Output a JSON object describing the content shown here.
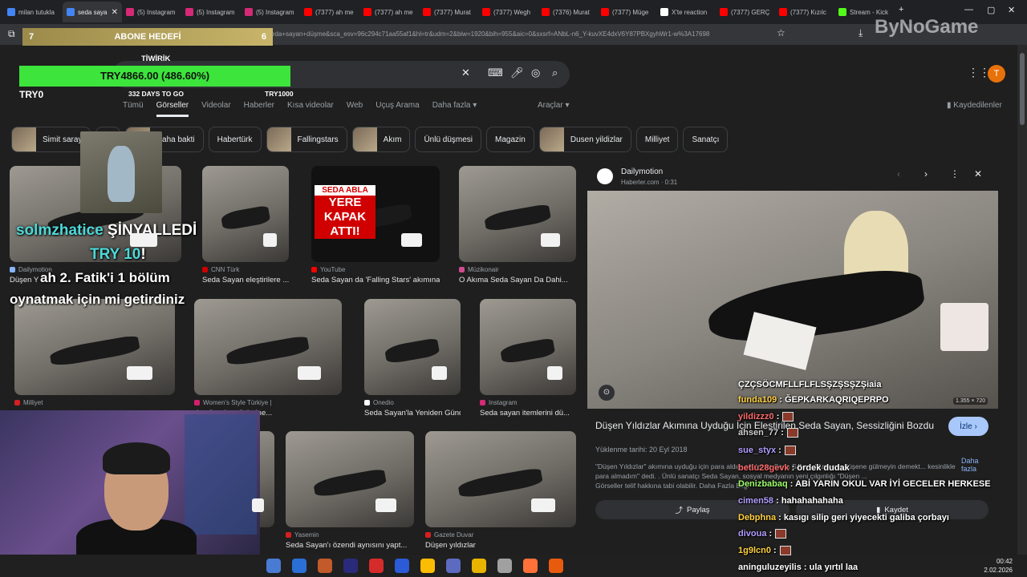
{
  "browser": {
    "tabs": [
      {
        "label": "milan tutukla",
        "color": "#4285f4",
        "active": false
      },
      {
        "label": "seda saya",
        "color": "#4285f4",
        "active": true
      },
      {
        "label": "(5) Instagram",
        "color": "#d62976",
        "active": false
      },
      {
        "label": "(5) Instagram",
        "color": "#d62976",
        "active": false
      },
      {
        "label": "(5) Instagram",
        "color": "#d62976",
        "active": false
      },
      {
        "label": "(7377) ah me",
        "color": "#ff0000",
        "active": false
      },
      {
        "label": "(7377) ah me",
        "color": "#ff0000",
        "active": false
      },
      {
        "label": "(7377) Murat",
        "color": "#ff0000",
        "active": false
      },
      {
        "label": "(7377) Wegh",
        "color": "#ff0000",
        "active": false
      },
      {
        "label": "(7376) Murat",
        "color": "#ff0000",
        "active": false
      },
      {
        "label": "(7377) Müge",
        "color": "#ff0000",
        "active": false
      },
      {
        "label": "X'te reaction",
        "color": "#ffffff",
        "active": false
      },
      {
        "label": "(7377) GERÇ",
        "color": "#ff0000",
        "active": false
      },
      {
        "label": "(7377) Kızılc",
        "color": "#ff0000",
        "active": false
      },
      {
        "label": "Stream - Kick",
        "color": "#53fc18",
        "active": false
      }
    ],
    "url": "eda+sayan+düşme&sca_esv=96c294c71aa55af1&hl=tr&udm=2&biw=1920&bih=955&aic=0&sxsrf=ANbL-n6_Y-kuvXE4dxV6Y87PBXgyhWr1-w%3A17698"
  },
  "google": {
    "nav": [
      "Tümü",
      "Görseller",
      "Videolar",
      "Haberler",
      "Kısa videolar",
      "Web",
      "Uçuş Arama",
      "Daha fazla ▾"
    ],
    "nav_active": "Görseller",
    "tools": "Araçlar ▾",
    "saved": "Kaydedilenler",
    "avatar": "T",
    "chips": [
      {
        "label": "Simit saray",
        "thumb": true
      },
      {
        "label": "rs",
        "thumb": false
      },
      {
        "label": "Daha bakti",
        "thumb": true
      },
      {
        "label": "Habertürk",
        "thumb": false
      },
      {
        "label": "Fallingstars",
        "thumb": true
      },
      {
        "label": "Akım",
        "thumb": true
      },
      {
        "label": "Ünlü düşmesi",
        "thumb": false
      },
      {
        "label": "Magazin",
        "thumb": false
      },
      {
        "label": "Dusen yildizlar",
        "thumb": true
      },
      {
        "label": "Milliyet",
        "thumb": false
      },
      {
        "label": "Sanatçı",
        "thumb": false
      }
    ],
    "results": [
      {
        "source": "Dailymotion",
        "caption": "Düşen Y"
      },
      {
        "source": "CNN Türk",
        "caption": "Seda Sayan eleştirilere ..."
      },
      {
        "source": "YouTube",
        "caption": "Seda Sayan da 'Falling Stars' akımına ..."
      },
      {
        "source": "Müzikonair",
        "caption": "O Akıma Seda Sayan Da Dahi..."
      },
      {
        "source": "Milliyet",
        "caption": ""
      },
      {
        "source": "Women's Style Türkiye |",
        "caption": "de görenler gözlerine..."
      },
      {
        "source": "Onedio",
        "caption": "Seda Sayan'la Yeniden Günd..."
      },
      {
        "source": "Instagram",
        "caption": "Seda sayan itemlerini dü..."
      },
      {
        "source": "Yasemin",
        "caption": "Seda Sayan'ı özendi aynısını yapt..."
      },
      {
        "source": "Gazete Duvar",
        "caption": "Düşen yıldızlar"
      },
      {
        "source": "",
        "caption": "a"
      }
    ],
    "thumb_text": [
      "SEDA ABLA",
      "YERE",
      "KAPAK",
      "ATTI!"
    ]
  },
  "panel": {
    "site": "Dailymotion",
    "subsite": "Haberler.com · 0:31",
    "size": "1.355 × 720",
    "title": "Düşen Yıldızlar Akımına Uyduğu İçin Eleştirilen Seda Sayan, Sessizliğini Bozdu",
    "visit": "İzle ›",
    "date": "Yüklenme tarihi: 20 Eyl 2018",
    "desc": "\"Düşen Yıldızlar\" akımına uyduğu için para aldığı söylenen Seda Sayan, \"Amacım düşene gülmeyin demekt... kesinlikle para almadım\" dedi. . Ünlü sanatçı Seda Sayan, sosyal medyanın yeni çılgınlığı \"Düşen ...",
    "more": "Daha fazla",
    "rights": "Görseller telif hakkına tabi olabilir. Daha Fazla Bilgi",
    "share": "Paylaş",
    "save": "Kaydet"
  },
  "overlay": {
    "abone_left": "7",
    "abone_label": "ABONE HEDEFİ",
    "abone_right": "6",
    "tiwirik": "TİWİRİK",
    "goal_text": "TRY4866.00 (486.60%)",
    "goal_fraction": 1,
    "goal_min": "TRY0",
    "goal_days": "332 DAYS TO GO",
    "goal_max": "TRY1000",
    "alert_user": "solmzhatice",
    "alert_action": "ŞİNYALLEDİ",
    "alert_amount": "TRY 10",
    "alert_bang": "!",
    "alert_msg1": "ah 2. Fatik'i 1 bölüm",
    "alert_msg2": "oynatmak için mi getirdiniz",
    "watermark": "ByNoGame"
  },
  "chat": [
    {
      "user": "",
      "msg": "ÇZÇSÖCMFLLFLFLSŞZŞSŞZŞiaia",
      "color": "#ffffff",
      "badge": false
    },
    {
      "user": "funda109",
      "msg": ": ĞEPKARKAQRIQEPRPO",
      "color": "#ffd23f",
      "badge": false
    },
    {
      "user": "yildizzz0",
      "msg": ":",
      "color": "#ff6b6b",
      "badge": true
    },
    {
      "user": "ahsen_77",
      "msg": ":",
      "color": "#cfcfcf",
      "badge": true
    },
    {
      "user": "sue_styx",
      "msg": ":",
      "color": "#b19dff",
      "badge": true
    },
    {
      "user": "betlu28gevk",
      "msg": ": ördek dudak",
      "color": "#ff6b6b",
      "badge": false
    },
    {
      "user": "Denizbabaq",
      "msg": ": ABİ YARIN OKUL VAR İYİ GECELER HERKESE",
      "color": "#9dff6b",
      "badge": false
    },
    {
      "user": "cimen58",
      "msg": ": hahahahahaha",
      "color": "#b19dff",
      "badge": false
    },
    {
      "user": "Debphna",
      "msg": ": kasıgı silip geri yiyecekti galiba çorbayı",
      "color": "#ffd23f",
      "badge": false
    },
    {
      "user": "divoua",
      "msg": ":",
      "color": "#b19dff",
      "badge": true
    },
    {
      "user": "1g9lcn0",
      "msg": ":",
      "color": "#ffd23f",
      "badge": true
    },
    {
      "user": "aninguluzeyilis",
      "msg": ": ula yırtıl laa",
      "color": "#ffffff",
      "badge": false
    }
  ],
  "clock": {
    "time": "00:42",
    "date": "2.02.2026"
  }
}
